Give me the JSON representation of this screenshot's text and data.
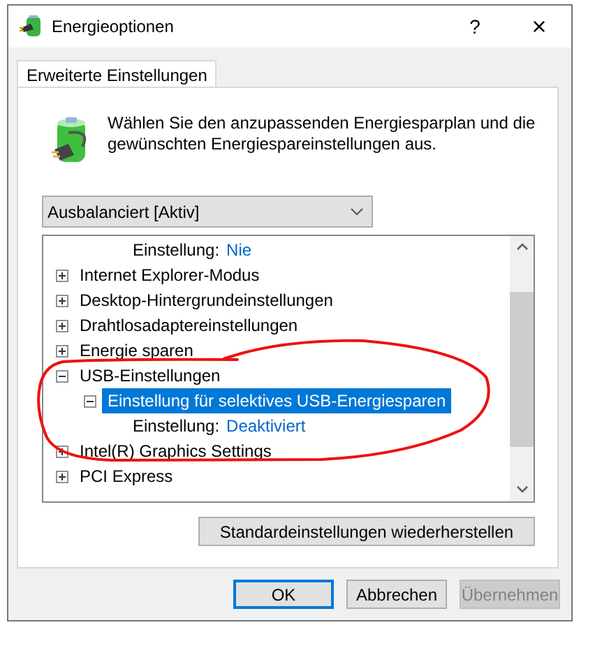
{
  "window": {
    "title": "Energieoptionen",
    "help": "?",
    "close": "×"
  },
  "tabs": [
    {
      "label": "Erweiterte Einstellungen",
      "selected": true
    }
  ],
  "description": "Wählen Sie den anzupassenden Energiesparplan und die gewünschten Energiespareinstellungen aus.",
  "plan_dropdown": {
    "value": "Ausbalanciert [Aktiv]"
  },
  "tree": [
    {
      "kind": "setting",
      "label": "Einstellung:",
      "value": "Nie"
    },
    {
      "kind": "group",
      "label": "Internet Explorer-Modus",
      "expanded": false,
      "selected": false
    },
    {
      "kind": "group",
      "label": "Desktop-Hintergrundeinstellungen",
      "expanded": false,
      "selected": false
    },
    {
      "kind": "group",
      "label": "Drahtlosadaptereinstellungen",
      "expanded": false,
      "selected": false
    },
    {
      "kind": "group",
      "label": "Energie sparen",
      "expanded": false,
      "selected": false
    },
    {
      "kind": "group",
      "label": "USB-Einstellungen",
      "expanded": true,
      "selected": false,
      "children": [
        {
          "kind": "group",
          "label": "Einstellung für selektives USB-Energiesparen",
          "expanded": true,
          "selected": true,
          "children": [
            {
              "kind": "setting",
              "label": "Einstellung:",
              "value": "Deaktiviert"
            }
          ]
        }
      ]
    },
    {
      "kind": "group",
      "label": "Intel(R) Graphics Settings",
      "expanded": false,
      "selected": false
    },
    {
      "kind": "group",
      "label": "PCI Express",
      "expanded": false,
      "selected": false
    }
  ],
  "restore_button": "Standardeinstellungen wiederherstellen",
  "buttons": [
    {
      "label": "OK",
      "default": true,
      "disabled": false
    },
    {
      "label": "Abbrechen",
      "default": false,
      "disabled": false
    },
    {
      "label": "Übernehmen",
      "default": false,
      "disabled": true
    }
  ],
  "annotation": {
    "kind": "freehand-ellipse"
  }
}
